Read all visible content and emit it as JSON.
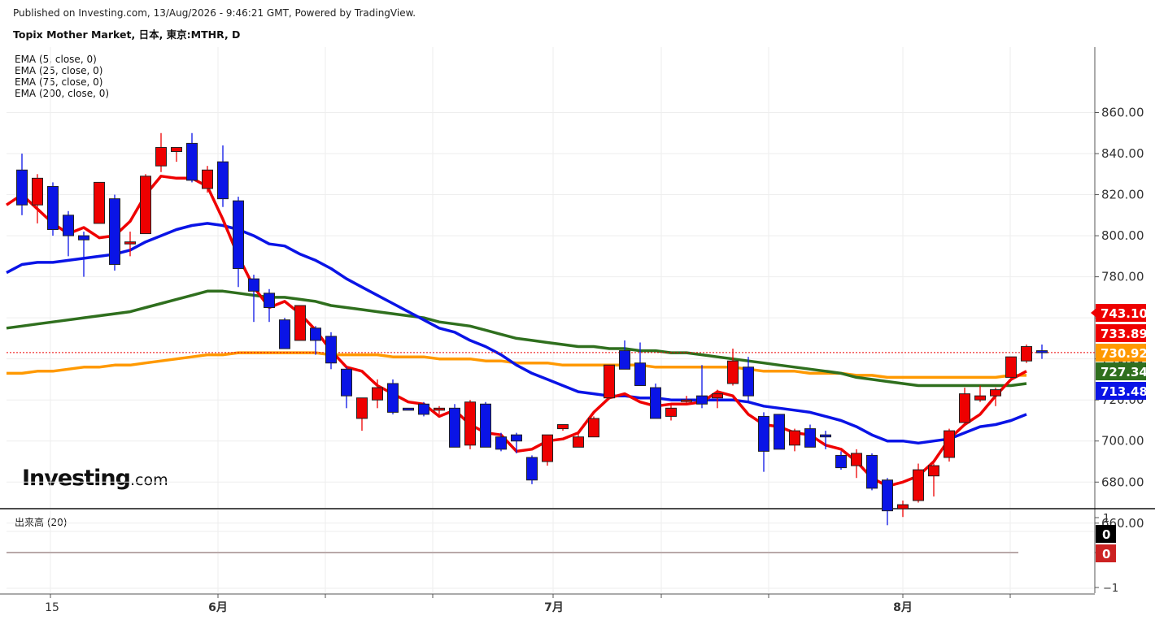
{
  "header": {
    "published": "Published on Investing.com, 13/Aug/2026 - 9:46:21 GMT, Powered by TradingView.",
    "symbol": "Topix Mother Market, 日本, 東京:MTHR, D"
  },
  "logo": {
    "main": "Investing",
    "suffix": ".com"
  },
  "indicators": [
    {
      "label": "EMA (5, close, 0)",
      "color": "#ef0000",
      "last": "733.89",
      "badge_text_color": "#ffffff"
    },
    {
      "label": "EMA (25, close, 0)",
      "color": "#0a14e6",
      "last": "713.48",
      "badge_text_color": "#ffffff"
    },
    {
      "label": "EMA (75, close, 0)",
      "color": "#2f6f1e",
      "last": "727.34",
      "badge_text_color": "#ffffff"
    },
    {
      "label": "EMA (200, close, 0)",
      "color": "#ff9900",
      "last": "730.92",
      "badge_text_color": "#ffffff"
    }
  ],
  "price_badge": {
    "value": "743.10",
    "color": "#ee0000"
  },
  "volume": {
    "label": "出来高 (20)",
    "badges": [
      {
        "value": "0",
        "color": "#000000"
      },
      {
        "value": "0",
        "color": "#cc2222"
      }
    ],
    "y_ticks": [
      "1",
      "0",
      "−1"
    ]
  },
  "colors": {
    "up": "#ee0000",
    "down": "#0a14e6",
    "grid": "#eeeeee"
  },
  "chart_data": {
    "type": "candlestick",
    "y_ticks": [
      "660.00",
      "680.00",
      "700.00",
      "720.00",
      "740.00",
      "760.00",
      "780.00",
      "800.00",
      "820.00",
      "840.00",
      "860.00"
    ],
    "x_ticks": [
      "15",
      "6月",
      "7月",
      "8月"
    ],
    "ylim": [
      650,
      868
    ],
    "candles": [
      [
        832,
        840,
        810,
        815
      ],
      [
        815,
        830,
        806,
        828
      ],
      [
        824,
        826,
        800,
        803
      ],
      [
        810,
        812,
        790,
        800
      ],
      [
        800,
        802,
        780,
        798
      ],
      [
        806,
        826,
        806,
        826
      ],
      [
        818,
        820,
        783,
        786
      ],
      [
        796,
        802,
        790,
        797
      ],
      [
        801,
        830,
        801,
        829
      ],
      [
        834,
        850,
        831,
        843
      ],
      [
        841,
        843,
        836,
        843
      ],
      [
        845,
        850,
        826,
        827
      ],
      [
        823,
        834,
        821,
        832
      ],
      [
        836,
        844,
        814,
        818
      ],
      [
        817,
        819,
        775,
        784
      ],
      [
        779,
        781,
        758,
        773
      ],
      [
        772,
        774,
        758,
        765
      ],
      [
        759,
        760,
        746,
        745
      ],
      [
        749,
        766,
        749,
        766
      ],
      [
        755,
        756,
        742,
        749
      ],
      [
        751,
        753,
        735,
        738
      ],
      [
        735,
        736,
        716,
        722
      ],
      [
        711,
        721,
        705,
        721
      ],
      [
        720,
        730,
        716,
        726
      ],
      [
        728,
        730,
        713,
        714
      ],
      [
        716,
        716,
        715,
        715
      ],
      [
        718,
        719,
        712,
        713
      ],
      [
        715,
        717,
        713,
        716
      ],
      [
        716,
        718,
        702,
        697
      ],
      [
        698,
        720,
        696,
        719
      ],
      [
        718,
        719,
        697,
        697
      ],
      [
        702,
        704,
        695,
        696
      ],
      [
        703,
        704,
        694,
        700
      ],
      [
        692,
        693,
        679,
        681
      ],
      [
        690,
        703,
        688,
        703
      ],
      [
        706,
        708,
        705,
        708
      ],
      [
        697,
        704,
        697,
        702
      ],
      [
        702,
        712,
        702,
        711
      ],
      [
        721,
        736,
        721,
        737
      ],
      [
        744,
        749,
        743,
        735
      ],
      [
        738,
        748,
        730,
        727
      ],
      [
        726,
        728,
        712,
        711
      ],
      [
        712,
        718,
        710,
        716
      ],
      [
        720,
        722,
        718,
        720
      ],
      [
        722,
        737,
        716,
        718
      ],
      [
        721,
        725,
        716,
        723
      ],
      [
        728,
        745,
        727,
        739
      ],
      [
        736,
        741,
        719,
        722
      ],
      [
        712,
        714,
        685,
        695
      ],
      [
        713,
        713,
        696,
        696
      ],
      [
        698,
        706,
        695,
        705
      ],
      [
        706,
        708,
        698,
        697
      ],
      [
        703,
        705,
        696,
        702
      ],
      [
        693,
        695,
        686,
        687
      ],
      [
        688,
        696,
        682,
        694
      ],
      [
        693,
        694,
        676,
        677
      ],
      [
        681,
        682,
        659,
        666
      ],
      [
        667,
        671,
        663,
        669
      ],
      [
        671,
        689,
        670,
        686
      ],
      [
        683,
        689,
        673,
        688
      ],
      [
        692,
        706,
        690,
        705
      ],
      [
        709,
        726,
        709,
        723
      ],
      [
        720,
        727,
        719,
        722
      ],
      [
        722,
        726,
        717,
        725
      ],
      [
        731,
        737,
        730,
        741
      ],
      [
        739,
        747,
        738,
        746
      ],
      [
        744,
        747,
        740,
        743
      ]
    ],
    "ema": {
      "EMA (5, close, 0)": [
        815,
        820,
        813,
        806,
        801,
        804,
        799,
        800,
        807,
        820,
        829,
        828,
        828,
        824,
        808,
        790,
        775,
        765,
        768,
        762,
        754,
        744,
        736,
        734,
        727,
        723,
        719,
        718,
        712,
        715,
        708,
        704,
        703,
        695,
        696,
        700,
        701,
        704,
        714,
        721,
        723,
        719,
        717,
        718,
        718,
        719,
        724,
        722,
        713,
        708,
        707,
        704,
        703,
        698,
        696,
        690,
        682,
        678,
        680,
        683,
        690,
        701,
        708,
        713,
        722,
        730,
        734
      ],
      "EMA (25, close, 0)": [
        782,
        786,
        787,
        787,
        788,
        789,
        790,
        791,
        793,
        797,
        800,
        803,
        805,
        806,
        805,
        803,
        800,
        796,
        795,
        791,
        788,
        784,
        779,
        775,
        771,
        767,
        763,
        759,
        755,
        753,
        749,
        746,
        742,
        737,
        733,
        730,
        727,
        724,
        723,
        722,
        722,
        721,
        721,
        720,
        720,
        720,
        720,
        720,
        719,
        717,
        716,
        715,
        714,
        712,
        710,
        707,
        703,
        700,
        700,
        699,
        700,
        701,
        704,
        707,
        708,
        710,
        713
      ],
      "EMA (75, close, 0)": [
        755,
        756,
        757,
        758,
        759,
        760,
        761,
        762,
        763,
        765,
        767,
        769,
        771,
        773,
        773,
        772,
        771,
        770,
        770,
        769,
        768,
        766,
        765,
        764,
        763,
        762,
        761,
        760,
        758,
        757,
        756,
        754,
        752,
        750,
        749,
        748,
        747,
        746,
        746,
        745,
        745,
        744,
        744,
        743,
        743,
        742,
        741,
        740,
        739,
        738,
        737,
        736,
        735,
        734,
        733,
        731,
        730,
        729,
        728,
        727,
        727,
        727,
        727,
        727,
        727,
        727,
        728
      ],
      "EMA (200, close, 0)": [
        733,
        733,
        734,
        734,
        735,
        736,
        736,
        737,
        737,
        738,
        739,
        740,
        741,
        742,
        742,
        743,
        743,
        743,
        743,
        743,
        743,
        742,
        742,
        742,
        742,
        741,
        741,
        741,
        740,
        740,
        740,
        739,
        739,
        738,
        738,
        738,
        737,
        737,
        737,
        737,
        737,
        737,
        736,
        736,
        736,
        736,
        736,
        736,
        735,
        734,
        734,
        734,
        733,
        733,
        733,
        732,
        732,
        731,
        731,
        731,
        731,
        731,
        731,
        731,
        731,
        732,
        732
      ]
    },
    "last_price": 743.1
  }
}
